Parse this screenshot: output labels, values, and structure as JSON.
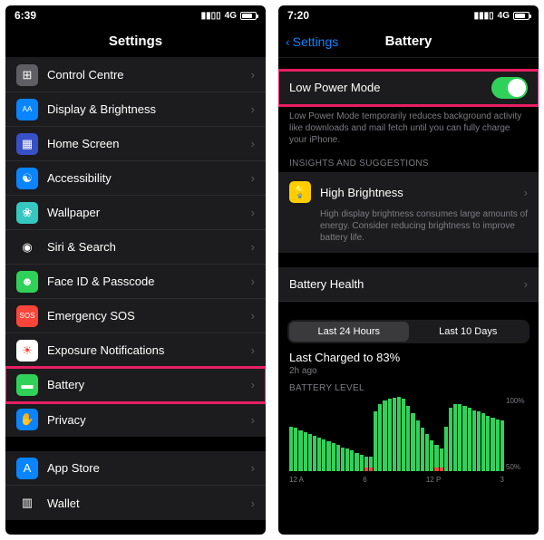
{
  "left": {
    "status": {
      "time": "6:39",
      "net": "4G"
    },
    "nav": {
      "title": "Settings"
    },
    "groups": [
      {
        "items": [
          {
            "label": "Control Centre",
            "icon": "control-centre-icon",
            "bg": "#5e5e63",
            "glyph": "⊞"
          },
          {
            "label": "Display & Brightness",
            "icon": "display-icon",
            "bg": "#0a84ff",
            "glyph": "AA"
          },
          {
            "label": "Home Screen",
            "icon": "home-screen-icon",
            "bg": "#3850c7",
            "glyph": "▦"
          },
          {
            "label": "Accessibility",
            "icon": "accessibility-icon",
            "bg": "#0a84ff",
            "glyph": "☯"
          },
          {
            "label": "Wallpaper",
            "icon": "wallpaper-icon",
            "bg": "#35c7c0",
            "glyph": "❀"
          },
          {
            "label": "Siri & Search",
            "icon": "siri-icon",
            "bg": "#1c1c1e",
            "glyph": "◉"
          },
          {
            "label": "Face ID & Passcode",
            "icon": "faceid-icon",
            "bg": "#30d158",
            "glyph": "☻"
          },
          {
            "label": "Emergency SOS",
            "icon": "sos-icon",
            "bg": "#ff453a",
            "glyph": "SOS"
          },
          {
            "label": "Exposure Notifications",
            "icon": "exposure-icon",
            "bg": "#ffffff",
            "glyph": "☀",
            "fg": "#ff3b30"
          },
          {
            "label": "Battery",
            "icon": "battery-icon",
            "bg": "#30d158",
            "glyph": "▬",
            "highlight": true
          },
          {
            "label": "Privacy",
            "icon": "privacy-icon",
            "bg": "#0a84ff",
            "glyph": "✋"
          }
        ]
      },
      {
        "items": [
          {
            "label": "App Store",
            "icon": "appstore-icon",
            "bg": "#0a84ff",
            "glyph": "A"
          },
          {
            "label": "Wallet",
            "icon": "wallet-icon",
            "bg": "#1c1c1e",
            "glyph": "▥"
          }
        ]
      }
    ]
  },
  "right": {
    "status": {
      "time": "7:20",
      "net": "4G"
    },
    "nav": {
      "title": "Battery",
      "back": "Settings"
    },
    "lpm": {
      "label": "Low Power Mode",
      "on": true,
      "highlight": true
    },
    "lpm_footer": "Low Power Mode temporarily reduces background activity like downloads and mail fetch until you can fully charge your iPhone.",
    "insights_header": "INSIGHTS AND SUGGESTIONS",
    "insight": {
      "title": "High Brightness",
      "desc": "High display brightness consumes large amounts of energy. Consider reducing brightness to improve battery life.",
      "icon_bg": "#ffcc00",
      "glyph": "💡"
    },
    "battery_health": "Battery Health",
    "segments": {
      "a": "Last 24 Hours",
      "b": "Last 10 Days",
      "selected": "a"
    },
    "last_charged": "Last Charged to 83%",
    "last_charged_sub": "2h ago",
    "level_header": "BATTERY LEVEL",
    "chart_data": {
      "type": "bar",
      "ylabel": "",
      "ylim": [
        0,
        100
      ],
      "y_ticks": [
        "100%",
        "50%"
      ],
      "x_ticks": [
        "12 A",
        "6",
        "12 P",
        "3"
      ],
      "values": [
        60,
        58,
        55,
        52,
        50,
        48,
        45,
        43,
        40,
        38,
        35,
        32,
        30,
        28,
        25,
        22,
        20,
        20,
        80,
        90,
        95,
        98,
        99,
        100,
        98,
        88,
        78,
        68,
        58,
        50,
        42,
        35,
        30,
        60,
        85,
        90,
        90,
        88,
        85,
        82,
        80,
        78,
        75,
        72,
        70,
        68
      ],
      "low_markers": [
        16,
        17,
        31,
        32
      ]
    }
  }
}
